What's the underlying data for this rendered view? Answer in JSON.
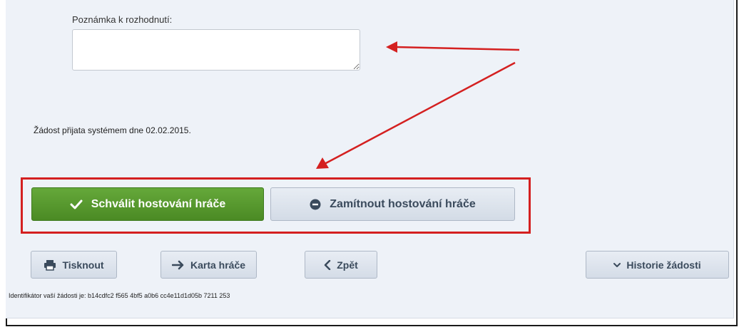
{
  "note": {
    "label": "Poznámka k rozhodnutí:",
    "value": "",
    "placeholder": ""
  },
  "received_text": "Žádost přijata systémem dne 02.02.2015.",
  "decision": {
    "approve_label": "Schválit hostování hráče",
    "reject_label": "Zamítnout hostování hráče"
  },
  "actions": {
    "print_label": "Tisknout",
    "player_card_label": "Karta hráče",
    "back_label": "Zpět",
    "history_label": "Historie žádosti"
  },
  "identifier_text": "Identifikátor vaší žádosti je: b14cdfc2 f565 4bf5 a0b6 cc4e11d1d05b 7211 253",
  "colors": {
    "panel_bg": "#eef2f8",
    "approve_green": "#4b8a24",
    "annotation_red": "#d42020",
    "button_text": "#3a4a5c"
  },
  "icons": {
    "approve": "checkmark-icon",
    "reject": "minus-circle-icon",
    "print": "printer-icon",
    "card": "arrow-right-icon",
    "back": "chevron-left-icon",
    "history": "chevron-down-icon"
  }
}
